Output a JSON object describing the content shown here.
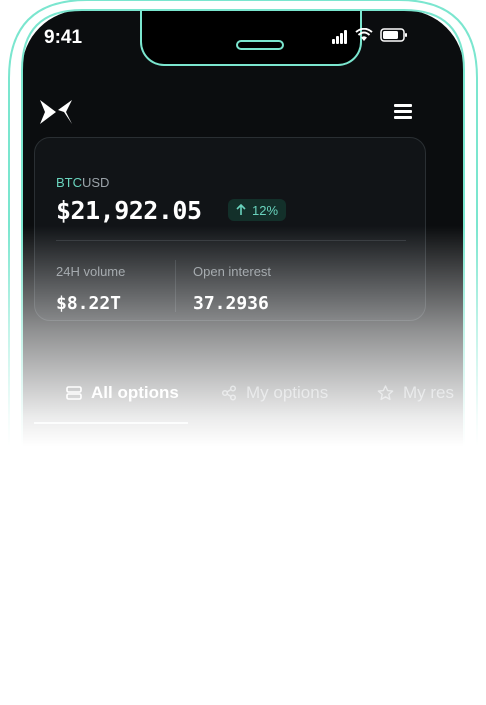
{
  "status_bar": {
    "time": "9:41"
  },
  "header": {
    "logo_icon": "arrow-x-logo-icon",
    "menu_icon": "hamburger-menu-icon"
  },
  "market_card": {
    "pair_base": "BTC",
    "pair_quote": "USD",
    "price": "$21,922.05",
    "change": "12%",
    "change_icon": "arrow-up-icon",
    "stats": [
      {
        "label": "24H volume",
        "value": "$8.22T"
      },
      {
        "label": "Open interest",
        "value": "37.2936"
      }
    ]
  },
  "tabs": [
    {
      "label": "All options",
      "icon": "list-icon",
      "active": true
    },
    {
      "label": "My options",
      "icon": "share-nodes-icon",
      "active": false
    },
    {
      "label": "My res",
      "icon": "star-icon",
      "active": false
    }
  ],
  "colors": {
    "accent": "#69d3bd",
    "frame": "#7be6cf",
    "background": "#0b0d0f"
  }
}
